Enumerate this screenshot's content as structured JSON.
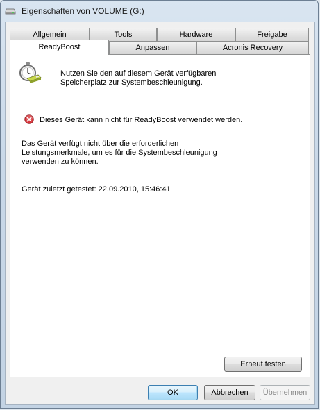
{
  "window": {
    "title": "Eigenschaften von VOLUME (G:)"
  },
  "tabs": {
    "row1": [
      "Allgemein",
      "Tools",
      "Hardware",
      "Freigabe"
    ],
    "row2": [
      "ReadyBoost",
      "Anpassen",
      "Acronis Recovery"
    ],
    "active": "ReadyBoost"
  },
  "readyboost": {
    "intro_line1": "Nutzen Sie den auf diesem Gerät verfügbaren",
    "intro_line2": "Speicherplatz zur Systembeschleunigung.",
    "error_message": "Dieses Gerät kann nicht für ReadyBoost verwendet werden.",
    "detail_line1": "Das Gerät verfügt nicht über die erforderlichen",
    "detail_line2": "Leistungsmerkmale, um es für die Systembeschleunigung",
    "detail_line3": "verwenden zu können.",
    "last_tested": "Gerät zuletzt getestet: 22.09.2010, 15:46:41",
    "retest_button": "Erneut testen"
  },
  "buttons": {
    "ok": "OK",
    "cancel": "Abbrechen",
    "apply": "Übernehmen"
  },
  "icons": {
    "title": "drive-icon",
    "readyboost": "readyboost-stopwatch-icon",
    "error": "error-icon"
  }
}
